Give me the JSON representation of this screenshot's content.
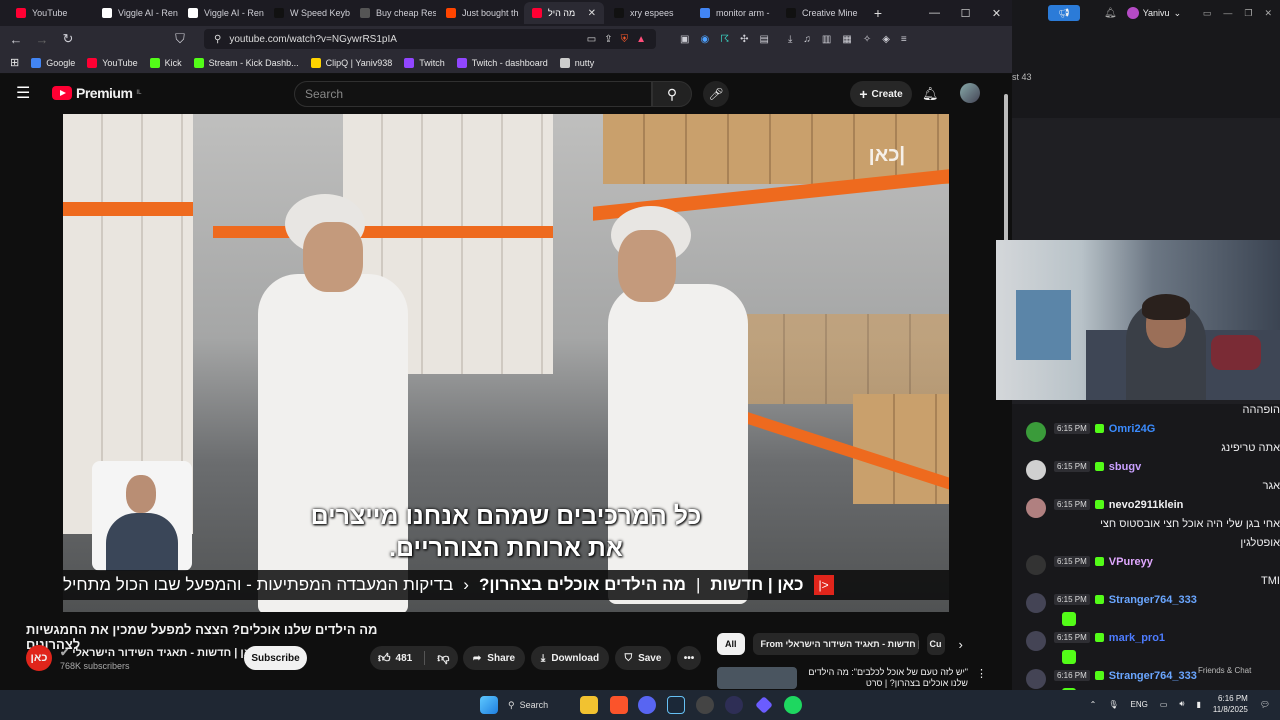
{
  "browser": {
    "tabs": [
      {
        "label": "YouTube",
        "color": "#ff0033"
      },
      {
        "label": "Viggle AI - Ren",
        "color": "#ffffff"
      },
      {
        "label": "Viggle AI - Ren",
        "color": "#ffffff"
      },
      {
        "label": "W Speed Keyb",
        "color": "#111111"
      },
      {
        "label": "Buy cheap Res",
        "color": "#555555"
      },
      {
        "label": "Just bought th",
        "color": "#ff4500"
      },
      {
        "label": "מה היל",
        "color": "#ff0033",
        "active": true
      },
      {
        "label": "xry espees",
        "color": "#111111"
      },
      {
        "label": "monitor arm -",
        "color": "#4285f4"
      },
      {
        "label": "Creative Mine",
        "color": "#111111"
      }
    ],
    "new_tab": "+",
    "url": "youtube.com/watch?v=NGywrRS1pIA",
    "bookmarks": [
      {
        "label": "Google",
        "color": "#4285f4"
      },
      {
        "label": "YouTube",
        "color": "#ff0033"
      },
      {
        "label": "Kick",
        "color": "#53fc18"
      },
      {
        "label": "Stream - Kick Dashb...",
        "color": "#53fc18"
      },
      {
        "label": "ClipQ | Yaniv938",
        "color": "#ffd400"
      },
      {
        "label": "Twitch",
        "color": "#9146ff"
      },
      {
        "label": "Twitch - dashboard",
        "color": "#9146ff"
      },
      {
        "label": "nutty",
        "color": "#cccccc"
      }
    ]
  },
  "youtube": {
    "logo": "Premium",
    "logo_region": "IL",
    "search_placeholder": "Search",
    "create_label": "Create",
    "video": {
      "channel_watermark": "כאן|",
      "subtitle_line1": "כל המרכיבים שמהם אנחנו מייצרים",
      "subtitle_line2": "את ארוחת הצוהריים.",
      "lower_third_brand": "כאן | חדשות",
      "lower_third_sep": "|",
      "lower_third_topic": "מה הילדים אוכלים בצהרון?",
      "lower_third_text": "בדיקות המעבדה המפתיעות - והמפעל שבו הכול מתחיל"
    },
    "title": "מה הילדים שלנו אוכלים? הצצה למפעל שמכין את החמגשיות לצהרונים",
    "channel_name": "כאן | חדשות - תאגיד השידור הישראלי",
    "channel_avatar": "כאן",
    "subscribers": "768K subscribers",
    "subscribe_label": "Subscribe",
    "likes": "481",
    "share_label": "Share",
    "download_label": "Download",
    "save_label": "Save",
    "chips": [
      "All",
      "From כאן | חדשות - תאגיד השידור הישראלי",
      "Cu"
    ],
    "rec_title": "\"יש לזה טעם של אוכל לכלבים\": מה הילדים שלנו אוכלים בצהרון? | סרט"
  },
  "twitch": {
    "user": "Yanivu",
    "viewer_text": "st 43",
    "messages": [
      {
        "time": "",
        "user": "",
        "color": "#efeff1",
        "text": "הופההה",
        "avatar": "#2e2e33"
      },
      {
        "time": "6:15 PM",
        "user": "Omri24G",
        "color": "#3b8cff",
        "text": "אתה טריפינג",
        "avatar": "#3a9b3a"
      },
      {
        "time": "6:15 PM",
        "user": "sbugv",
        "color": "#c9a0ff",
        "text": "אגר",
        "avatar": "#d0d0d0"
      },
      {
        "time": "6:15 PM",
        "user": "nevo2911klein",
        "color": "#efeff1",
        "text": "אחי בגן שלי היה אוכל חצי אובסטוס חצי",
        "text2": "אופטלגין",
        "avatar": "#b08080"
      },
      {
        "time": "6:15 PM",
        "user": "VPureyy",
        "color": "#e0a8ff",
        "text": "TMI",
        "avatar": "#333"
      },
      {
        "time": "6:15 PM",
        "user": "Stranger764_333",
        "color": "#6aa6ff",
        "text": "",
        "avatar": "#445"
      },
      {
        "time": "6:15 PM",
        "user": "mark_pro1",
        "color": "#4d7cff",
        "text": "",
        "avatar": "#445"
      },
      {
        "time": "6:16 PM",
        "user": "Stranger764_333",
        "color": "#6aa6ff",
        "text": "",
        "avatar": "#445"
      }
    ],
    "friends_label": "Friends & Chat"
  },
  "taskbar": {
    "search_label": "Search",
    "lang": "ENG",
    "time": "6:16 PM",
    "date": "11/8/2025"
  }
}
